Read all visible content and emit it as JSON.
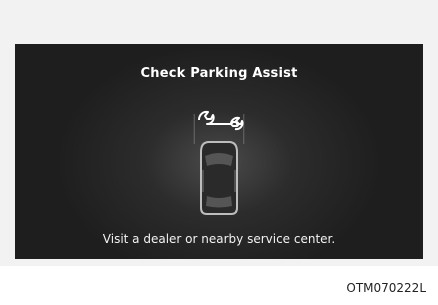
{
  "display": {
    "title": "Check Parking Assist",
    "message": "Visit a dealer or nearby service center."
  },
  "icons": {
    "warning": "wrench-icon",
    "vehicle": "car-top-view-icon"
  },
  "image_code": "OTM070222L"
}
